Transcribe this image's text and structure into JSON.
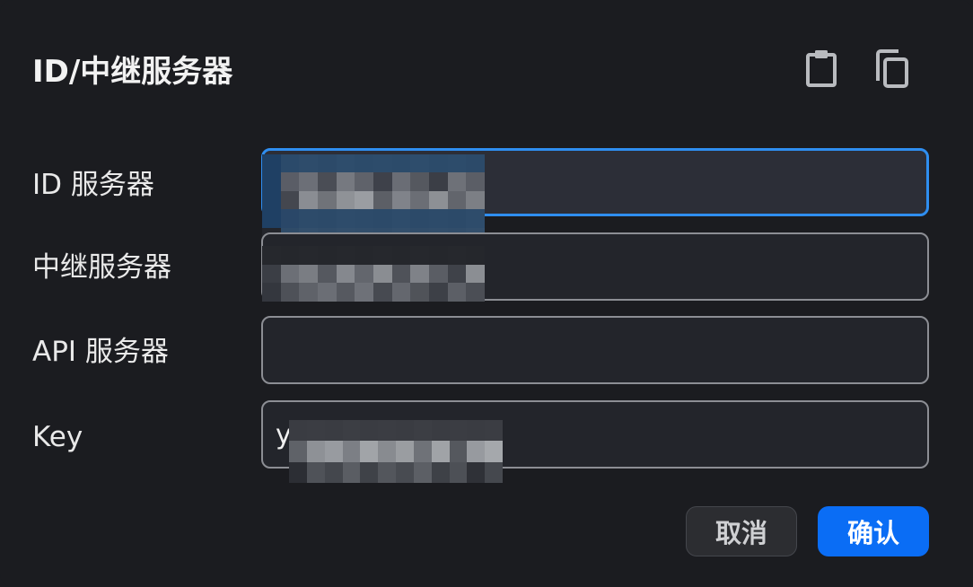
{
  "dialog": {
    "title": "ID/中继服务器",
    "icons": {
      "paste": "clipboard-paste-icon",
      "copy": "copy-icon"
    }
  },
  "fields": {
    "id_server": {
      "label": "ID 服务器",
      "value": ""
    },
    "relay_server": {
      "label": "中继服务器",
      "value": ""
    },
    "api_server": {
      "label": "API 服务器",
      "value": ""
    },
    "key": {
      "label": "Key",
      "value": "y"
    }
  },
  "buttons": {
    "cancel": "取消",
    "confirm": "确认"
  },
  "colors": {
    "background": "#1b1c20",
    "accent": "#0a6df5",
    "focus_border": "#2f8ef0"
  }
}
